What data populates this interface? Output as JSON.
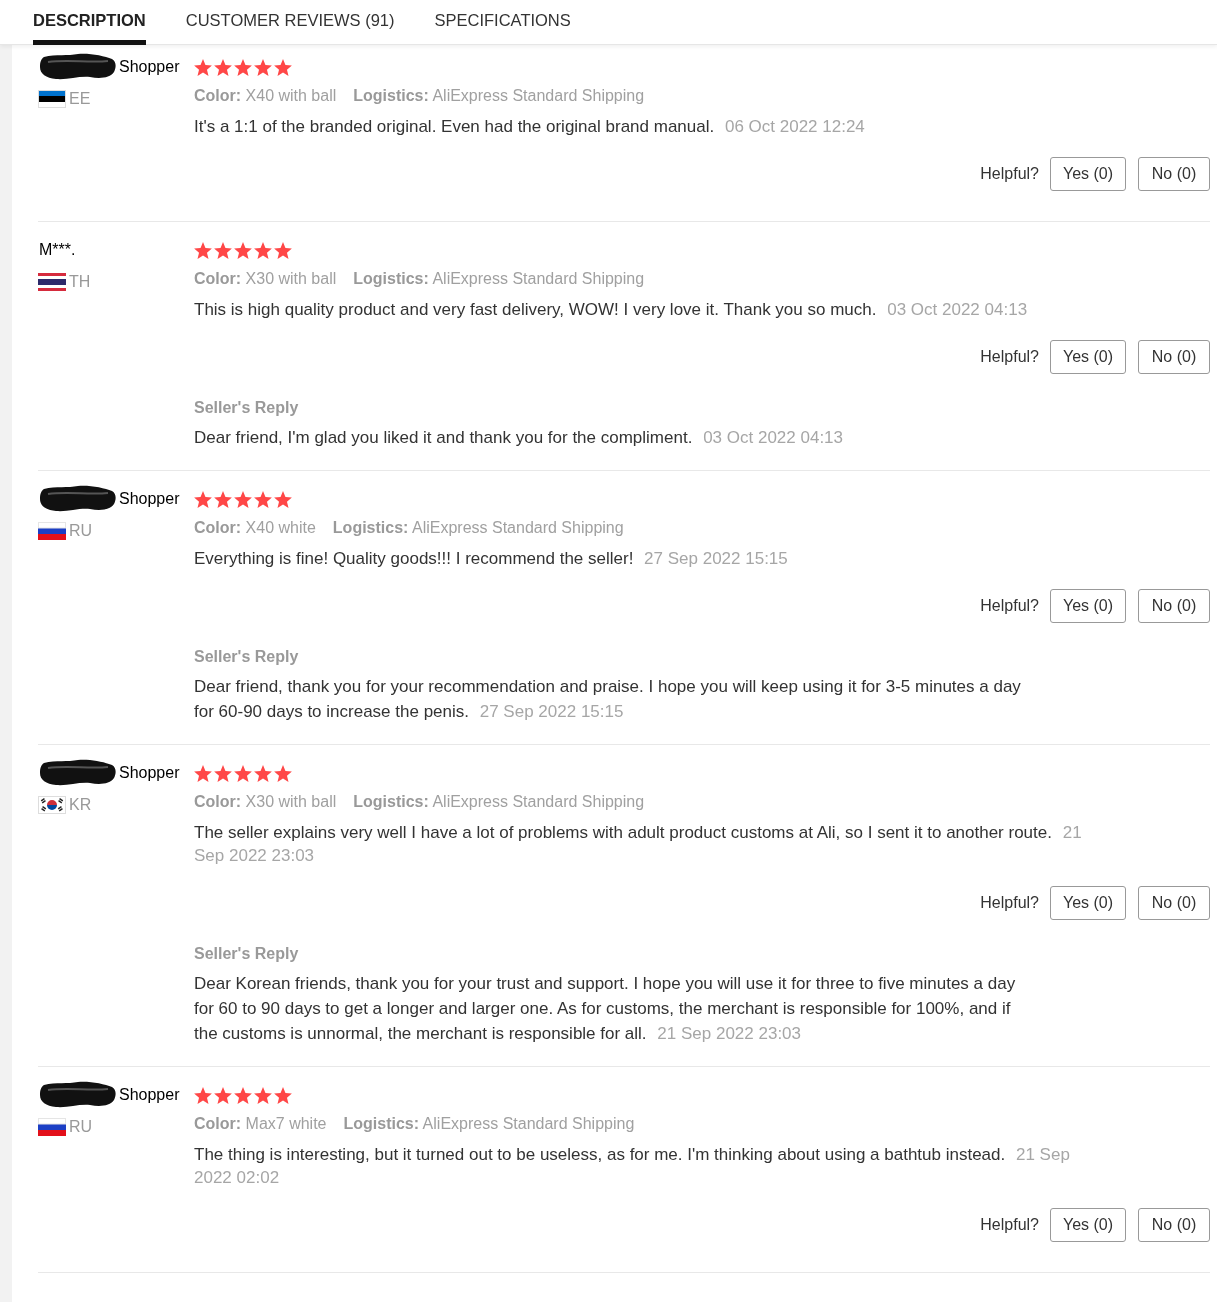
{
  "tabs": [
    {
      "label": "DESCRIPTION",
      "selected": true
    },
    {
      "label": "CUSTOMER REVIEWS (91)",
      "selected": false
    },
    {
      "label": "SPECIFICATIONS",
      "selected": false
    }
  ],
  "reviews": [
    {
      "reviewer": {
        "name": "Shopper",
        "name_redacted": true,
        "flag": {
          "kind": "estonia"
        },
        "country": "EE"
      },
      "stars": 5,
      "attributes": [
        {
          "label": "Color:",
          "value": "X40 with ball"
        },
        {
          "label": "Logistics:",
          "value": "AliExpress Standard Shipping"
        }
      ],
      "text": "It's a 1:1 of the branded original. Even had the original brand manual.",
      "date": "06 Oct 2022 12:24",
      "helpful": {
        "label": "Helpful?",
        "yes": "Yes (0)",
        "no": "No (0)"
      }
    },
    {
      "reviewer": {
        "name": "M***.",
        "name_redacted": false,
        "flag": {
          "kind": "thailand"
        },
        "country": "TH"
      },
      "stars": 5,
      "attributes": [
        {
          "label": "Color:",
          "value": "X30 with ball"
        },
        {
          "label": "Logistics:",
          "value": "AliExpress Standard Shipping"
        }
      ],
      "text": "This is high quality product and very fast delivery, WOW! I very love it. Thank you so much.",
      "date": "03 Oct 2022 04:13",
      "helpful": {
        "label": "Helpful?",
        "yes": "Yes (0)",
        "no": "No (0)"
      },
      "seller_reply": {
        "label": "Seller's Reply",
        "text": "Dear friend, I'm glad you liked it and thank you for the compliment.",
        "date": "03 Oct 2022 04:13"
      }
    },
    {
      "reviewer": {
        "name": "Shopper",
        "name_redacted": true,
        "flag": {
          "kind": "russia"
        },
        "country": "RU"
      },
      "stars": 5,
      "attributes": [
        {
          "label": "Color:",
          "value": "X40 white"
        },
        {
          "label": "Logistics:",
          "value": "AliExpress Standard Shipping"
        }
      ],
      "text": "Everything is fine! Quality goods!!! I recommend the seller!",
      "date": "27 Sep 2022 15:15",
      "helpful": {
        "label": "Helpful?",
        "yes": "Yes (0)",
        "no": "No (0)"
      },
      "seller_reply": {
        "label": "Seller's Reply",
        "text": "Dear friend, thank you for your recommendation and praise. I hope you will keep using it for 3-5 minutes a day for 60-90 days to increase the penis.",
        "date": "27 Sep 2022 15:15"
      }
    },
    {
      "reviewer": {
        "name": "Shopper",
        "name_redacted": true,
        "flag": {
          "kind": "korea"
        },
        "country": "KR"
      },
      "stars": 5,
      "attributes": [
        {
          "label": "Color:",
          "value": "X30 with ball"
        },
        {
          "label": "Logistics:",
          "value": "AliExpress Standard Shipping"
        }
      ],
      "text": "The seller explains very well I have a lot of problems with adult product customs at Ali, so I sent it to another route.",
      "date": "21 Sep 2022 23:03",
      "helpful": {
        "label": "Helpful?",
        "yes": "Yes (0)",
        "no": "No (0)"
      },
      "seller_reply": {
        "label": "Seller's Reply",
        "text": "Dear Korean friends, thank you for your trust and support. I hope you will use it for three to five minutes a day for 60 to 90 days to get a longer and larger one. As for customs, the merchant is responsible for 100%, and if the customs is unnormal, the merchant is responsible for all.",
        "date": "21 Sep 2022 23:03"
      }
    },
    {
      "reviewer": {
        "name": "Shopper",
        "name_redacted": true,
        "flag": {
          "kind": "russia"
        },
        "country": "RU"
      },
      "stars": 5,
      "attributes": [
        {
          "label": "Color:",
          "value": "Max7 white"
        },
        {
          "label": "Logistics:",
          "value": "AliExpress Standard Shipping"
        }
      ],
      "text": "The thing is interesting, but it turned out to be useless, as for me. I'm thinking about using a bathtub instead.",
      "date": "21 Sep 2022 02:02",
      "helpful": {
        "label": "Helpful?",
        "yes": "Yes (0)",
        "no": "No (0)"
      }
    }
  ]
}
